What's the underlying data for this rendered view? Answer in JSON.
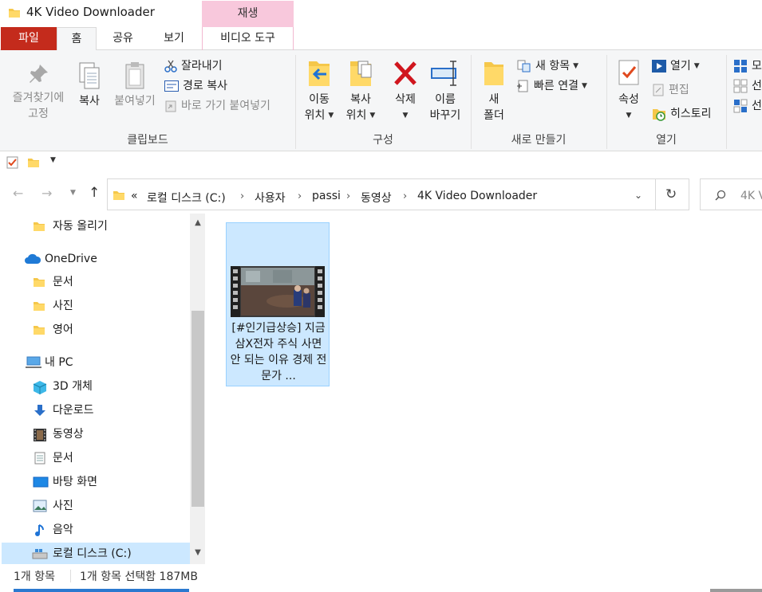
{
  "window": {
    "title": "4K Video Downloader",
    "context_group": "재생"
  },
  "tabs": {
    "file": "파일",
    "home": "홈",
    "share": "공유",
    "view": "보기",
    "video_tools": "비디오 도구"
  },
  "ribbon": {
    "clipboard": {
      "label": "클립보드",
      "pin_line1": "즐겨찾기에",
      "pin_line2": "고정",
      "copy": "복사",
      "paste": "붙여넣기",
      "cut": "잘라내기",
      "copy_path": "경로 복사",
      "paste_shortcut": "바로 가기 붙여넣기"
    },
    "organize": {
      "label": "구성",
      "move_line1": "이동",
      "move_line2": "위치",
      "copy_line1": "복사",
      "copy_line2": "위치",
      "delete": "삭제",
      "rename_line1": "이름",
      "rename_line2": "바꾸기"
    },
    "new": {
      "label": "새로 만들기",
      "new_folder_line1": "새",
      "new_folder_line2": "폴더",
      "new_item": "새 항목",
      "easy_access": "빠른 연결"
    },
    "open": {
      "label": "열기",
      "properties": "속성",
      "open": "열기",
      "edit": "편집",
      "history": "히스토리"
    },
    "select": {
      "select_all": "모",
      "select_none": "선",
      "invert": "선"
    }
  },
  "address": {
    "overflow": "«",
    "crumbs": [
      "로컬 디스크 (C:)",
      "사용자",
      "passi",
      "동영상",
      "4K Video Downloader"
    ],
    "search_placeholder": "4K V"
  },
  "nav": {
    "items": [
      {
        "label": "자동 올리기",
        "icon": "folder-icon"
      },
      {
        "label": "OneDrive",
        "icon": "cloud-icon"
      },
      {
        "label": "문서",
        "icon": "folder-icon"
      },
      {
        "label": "사진",
        "icon": "folder-icon"
      },
      {
        "label": "영어",
        "icon": "folder-icon"
      },
      {
        "label": "내 PC",
        "icon": "pc-icon"
      },
      {
        "label": "3D 개체",
        "icon": "cube-icon"
      },
      {
        "label": "다운로드",
        "icon": "download-icon"
      },
      {
        "label": "동영상",
        "icon": "film-icon"
      },
      {
        "label": "문서",
        "icon": "document-icon"
      },
      {
        "label": "바탕 화면",
        "icon": "desktop-icon"
      },
      {
        "label": "사진",
        "icon": "picture-icon"
      },
      {
        "label": "음악",
        "icon": "music-icon"
      },
      {
        "label": "로컬 디스크 (C:)",
        "icon": "drive-icon"
      }
    ]
  },
  "files": [
    {
      "name": "[#인기급상승] 지금 삼X전자 주식 사면 안 되는 이유 경제 전문가 ..."
    }
  ],
  "status": {
    "count": "1개 항목",
    "selected": "1개 항목 선택함 187MB"
  },
  "colors": {
    "file_tab": "#c42b1c",
    "selection": "#cce8ff",
    "context_group": "#f8c8dc",
    "accent": "#2b79d0"
  }
}
